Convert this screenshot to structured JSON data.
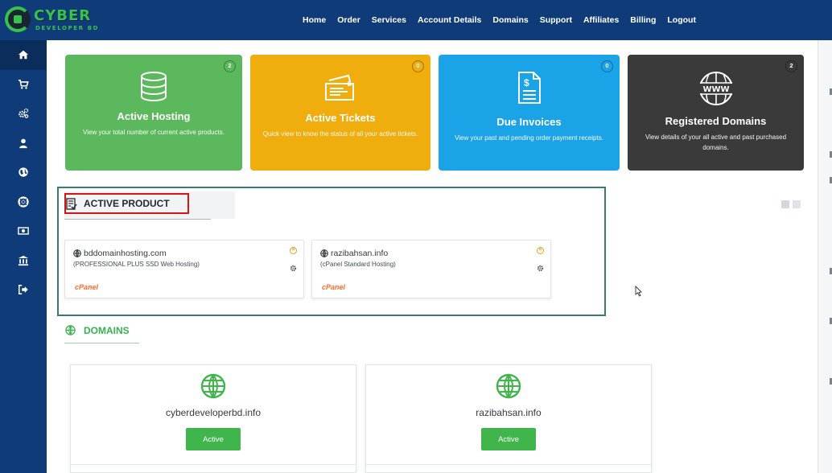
{
  "brand": {
    "name": "CYBER",
    "subtitle": "DEVELOPER BD"
  },
  "nav": {
    "items": [
      "Home",
      "Order",
      "Services",
      "Account Details",
      "Domains",
      "Support",
      "Affiliates",
      "Billing",
      "Logout"
    ]
  },
  "sidebar": {
    "icons": [
      "home-icon",
      "cart-icon",
      "cogs-icon",
      "user-icon",
      "globe-icon",
      "support-icon",
      "money-icon",
      "bank-icon",
      "sign-out-icon"
    ]
  },
  "cards": [
    {
      "title": "Active Hosting",
      "desc": "View your total number of current active products.",
      "badge": "2",
      "color": "#5cb85c",
      "icon": "database-icon"
    },
    {
      "title": "Active Tickets",
      "desc": "Quick view to know the status of all your active tickets.",
      "badge": "0",
      "color": "#f0ad0e",
      "icon": "ticket-icon"
    },
    {
      "title": "Due Invoices",
      "desc": "View your past and pending order payment receipts.",
      "badge": "0",
      "color": "#1ba3e8",
      "icon": "invoice-icon"
    },
    {
      "title": "Registered Domains",
      "desc": "View details of your all active and past purchased domains.",
      "badge": "2",
      "color": "#3a3a3a",
      "icon": "www-icon"
    }
  ],
  "active_product": {
    "title": "ACTIVE PRODUCT",
    "items": [
      {
        "domain": "bddomainhosting.com",
        "plan": "(PROFESSIONAL PLUS SSD Web Hosting)",
        "panel": "cPanel"
      },
      {
        "domain": "razibahsan.info",
        "plan": "(cPanel Standard Hosting)",
        "panel": "cPanel"
      }
    ]
  },
  "domains": {
    "title": "DOMAINS",
    "items": [
      {
        "name": "cyberdeveloperbd.info",
        "status": "Active"
      },
      {
        "name": "razibahsan.info",
        "status": "Active"
      }
    ]
  },
  "colors": {
    "nav_bg": "#0f3c78",
    "accent_green": "#3fb54b",
    "highlight_red": "#d11616"
  }
}
